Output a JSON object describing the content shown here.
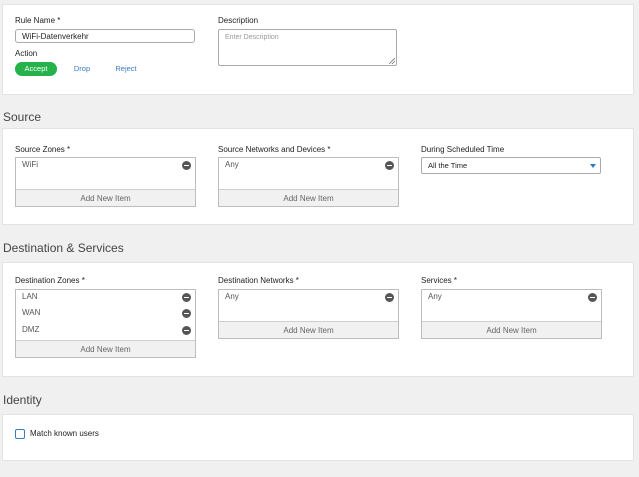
{
  "rule": {
    "name_label": "Rule Name *",
    "name_value": "WiFi-Datenverkehr",
    "description_label": "Description",
    "description_placeholder": "Enter Description",
    "action_label": "Action",
    "actions": [
      "Accept",
      "Drop",
      "Reject"
    ],
    "selected_action": "Accept"
  },
  "source": {
    "title": "Source",
    "zones_label": "Source Zones *",
    "zones": [
      "WiFi"
    ],
    "networks_label": "Source Networks and Devices *",
    "networks": [
      "Any"
    ],
    "schedule_label": "During Scheduled Time",
    "schedule_value": "All the Time"
  },
  "destination": {
    "title": "Destination & Services",
    "zones_label": "Destination Zones *",
    "zones": [
      "LAN",
      "WAN",
      "DMZ"
    ],
    "networks_label": "Destination Networks *",
    "networks": [
      "Any"
    ],
    "services_label": "Services *",
    "services": [
      "Any"
    ]
  },
  "add_new_item": "Add New Item",
  "identity": {
    "title": "Identity",
    "match_known_users_label": "Match known users",
    "match_known_users_checked": false
  },
  "colors": {
    "accent_green": "#26b24b",
    "link_blue": "#3a7bbf",
    "caret_blue": "#2a7ec8"
  }
}
